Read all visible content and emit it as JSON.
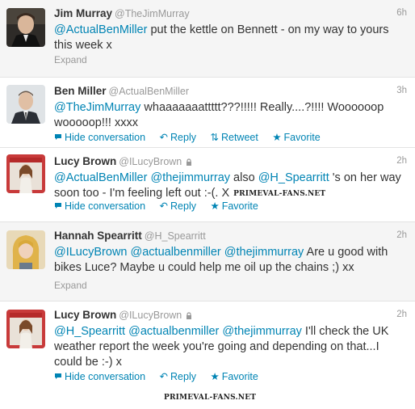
{
  "tweets": [
    {
      "name": "Jim Murray",
      "handle": "@TheJimMurray",
      "time": "6h",
      "text": [
        {
          "t": "@ActualBenMiller",
          "m": true
        },
        {
          "t": " put the kettle on Bennett - on my way to yours this week x",
          "m": false
        }
      ],
      "expand": "Expand"
    },
    {
      "name": "Ben Miller",
      "handle": "@ActualBenMiller",
      "time": "3h",
      "text": [
        {
          "t": "@TheJimMurray",
          "m": true
        },
        {
          "t": " whaaaaaaattttt???!!!!! Really....?!!!! Woooooop wooooop!!! xxxx",
          "m": false
        }
      ],
      "actions": {
        "hide": "Hide conversation",
        "reply": "Reply",
        "retweet": "Retweet",
        "favorite": "Favorite"
      }
    },
    {
      "name": "Lucy Brown",
      "handle": "@ILucyBrown",
      "time": "2h",
      "text": [
        {
          "t": "@ActualBenMiller",
          "m": true
        },
        {
          "t": " ",
          "m": false
        },
        {
          "t": "@thejimmurray",
          "m": true
        },
        {
          "t": " also ",
          "m": false
        },
        {
          "t": "@H_Spearritt",
          "m": true
        },
        {
          "t": " 's on her way soon too - I'm feeling left out :-(. X",
          "m": false
        }
      ],
      "watermark": "PRIMEVAL-FANS.NET",
      "actions": {
        "hide": "Hide conversation",
        "reply": "Reply",
        "favorite": "Favorite"
      }
    },
    {
      "name": "Hannah Spearritt",
      "handle": "@H_Spearritt",
      "time": "2h",
      "text": [
        {
          "t": "@ILucyBrown",
          "m": true
        },
        {
          "t": " ",
          "m": false
        },
        {
          "t": "@actualbenmiller",
          "m": true
        },
        {
          "t": " ",
          "m": false
        },
        {
          "t": "@thejimmurray",
          "m": true
        },
        {
          "t": " Are u good with bikes Luce? Maybe u could help me oil up the chains ;) xx",
          "m": false
        }
      ],
      "expand": "Expand"
    },
    {
      "name": "Lucy Brown",
      "handle": "@ILucyBrown",
      "time": "2h",
      "text": [
        {
          "t": "@H_Spearritt",
          "m": true
        },
        {
          "t": " ",
          "m": false
        },
        {
          "t": "@actualbenmiller",
          "m": true
        },
        {
          "t": " ",
          "m": false
        },
        {
          "t": "@thejimmurray",
          "m": true
        },
        {
          "t": " I'll check the UK weather report the week you're going and depending on that...I could be :-) x",
          "m": false
        }
      ],
      "actions": {
        "hide": "Hide conversation",
        "reply": "Reply",
        "favorite": "Favorite"
      }
    }
  ],
  "footer_watermark": "PRIMEVAL-FANS.NET",
  "colors": {
    "link": "#0084b4",
    "muted": "#999999",
    "highlight_bg": "#f5f5f5",
    "divider": "#e3e3e3"
  },
  "icons": [
    "lock-icon",
    "hide-conversation-icon",
    "reply-icon",
    "retweet-icon",
    "favorite-icon"
  ]
}
